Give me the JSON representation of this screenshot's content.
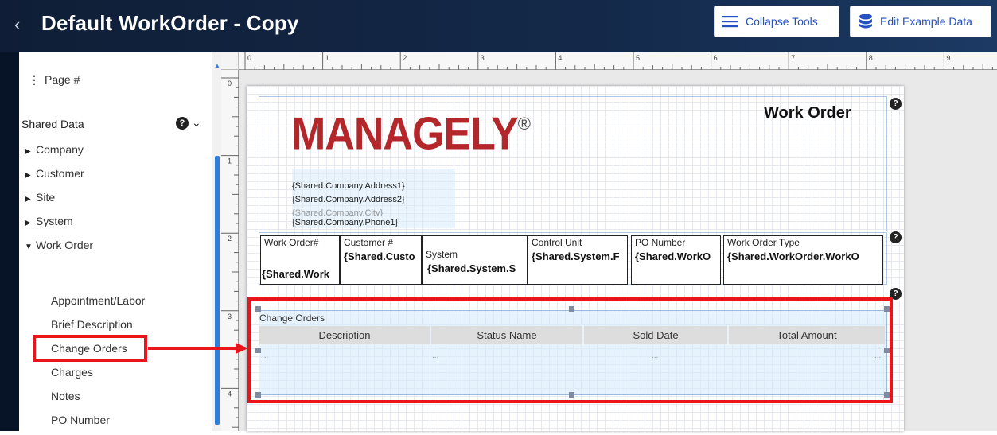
{
  "header": {
    "back_icon": "chevron-left-icon",
    "title": "Default WorkOrder - Copy",
    "collapse_tools_label": "Collapse Tools",
    "edit_example_data_label": "Edit Example Data"
  },
  "sidebar": {
    "page_number_label": "Page #",
    "shared_data_label": "Shared Data",
    "tree": [
      "Company",
      "Customer",
      "Site",
      "System",
      "Work Order"
    ],
    "work_order_fields": [
      "Appointment/Labor",
      "Brief Description",
      "Change Orders",
      "Charges",
      "Notes",
      "PO Number"
    ]
  },
  "ruler": {
    "h_numbers": [
      "0",
      "1",
      "2",
      "3",
      "4",
      "5",
      "6",
      "7",
      "8",
      "9"
    ],
    "v_numbers": [
      "0",
      "1",
      "2",
      "3",
      "4"
    ]
  },
  "report": {
    "logo_text": "MANAGELY",
    "logo_mark": "®",
    "title": "Work Order",
    "address_lines": [
      "{Shared.Company.Address1}",
      "{Shared.Company.Address2}",
      "{Shared.Company.City}",
      "{Shared.Company.Phone1}"
    ],
    "info_cells": [
      {
        "label": "Work Order#",
        "field": "{Shared.Work"
      },
      {
        "label": "Customer #",
        "field": "{Shared.Custo"
      },
      {
        "label": "System",
        "field": "{Shared.System.S"
      },
      {
        "label": "Control Unit",
        "field": "{Shared.System.F"
      },
      {
        "label": "PO Number",
        "field": "{Shared.WorkO"
      },
      {
        "label": "Work Order Type",
        "field": "{Shared.WorkOrder.WorkO"
      }
    ],
    "change_orders": {
      "title": "Change Orders",
      "columns": [
        "Description",
        "Status Name",
        "Sold Date",
        "Total Amount"
      ],
      "row_placeholders": [
        "...",
        "...",
        "...",
        "..."
      ]
    }
  },
  "colors": {
    "header_bg": "#0f1e36",
    "accent_blue": "#2450c2",
    "highlight_red": "#e8151a",
    "logo_red": "#b3262a",
    "logo_gray": "#4d4d4d"
  }
}
